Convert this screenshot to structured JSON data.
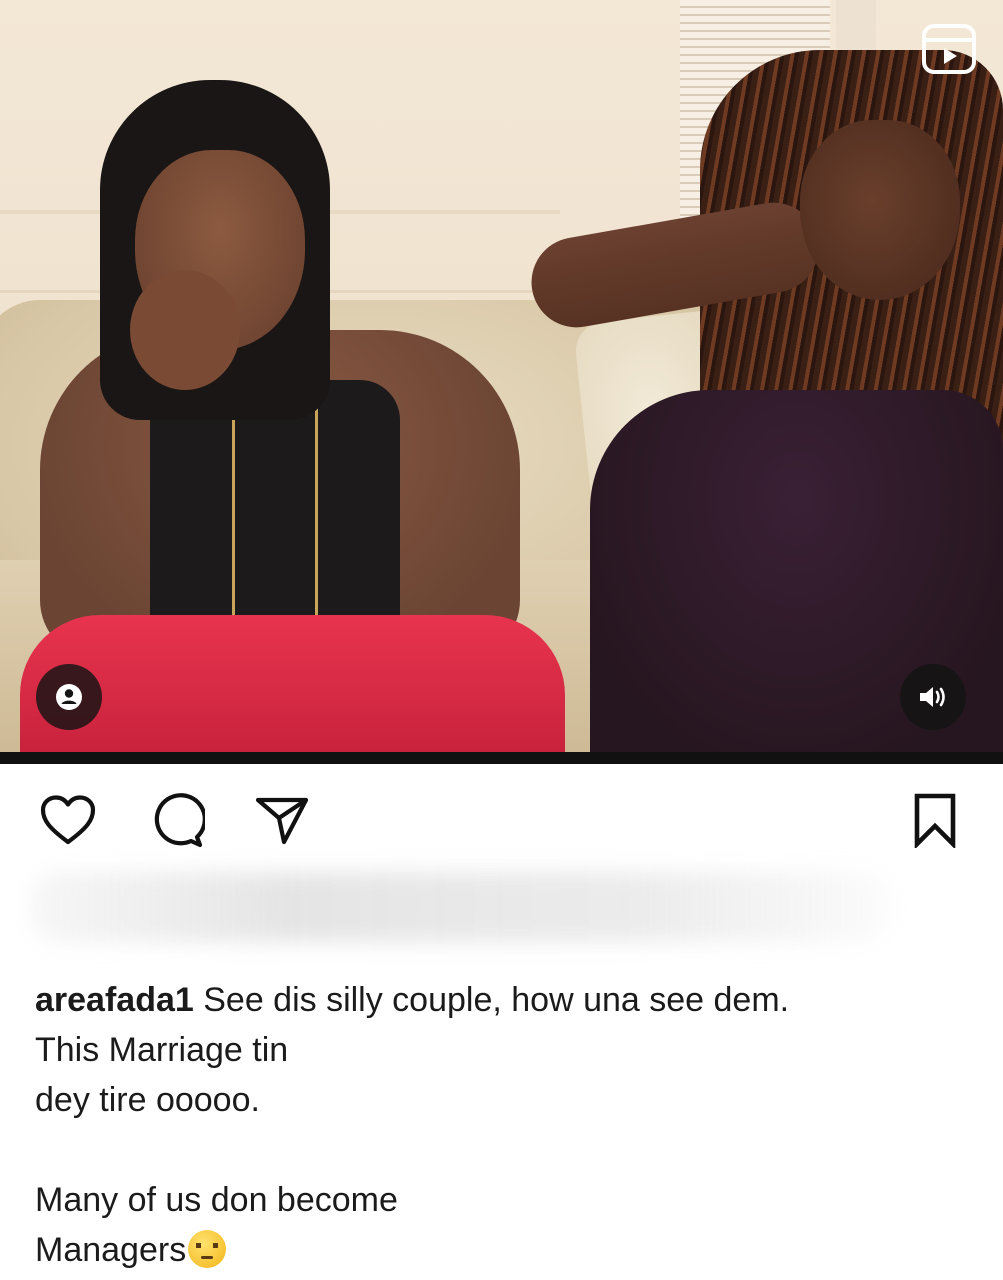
{
  "post": {
    "media": {
      "type": "reel-video",
      "reel_icon": "reels-icon",
      "tag_icon": "user-tag-icon",
      "sound_icon": "volume-icon"
    },
    "actions": {
      "like_icon": "heart-icon",
      "comment_icon": "comment-bubble-icon",
      "share_icon": "paper-plane-icon",
      "save_icon": "bookmark-icon"
    },
    "caption": {
      "username": "areafada1",
      "line1": " See dis silly couple, how una see dem.",
      "line2": "This Marriage tin",
      "line3": "dey tire ooooo.",
      "line4": "Many of us don become",
      "line5": "Managers",
      "emoji": "🤨"
    }
  },
  "colors": {
    "text": "#1b1b1b",
    "background": "#ffffff",
    "overlay_button": "#141414"
  }
}
